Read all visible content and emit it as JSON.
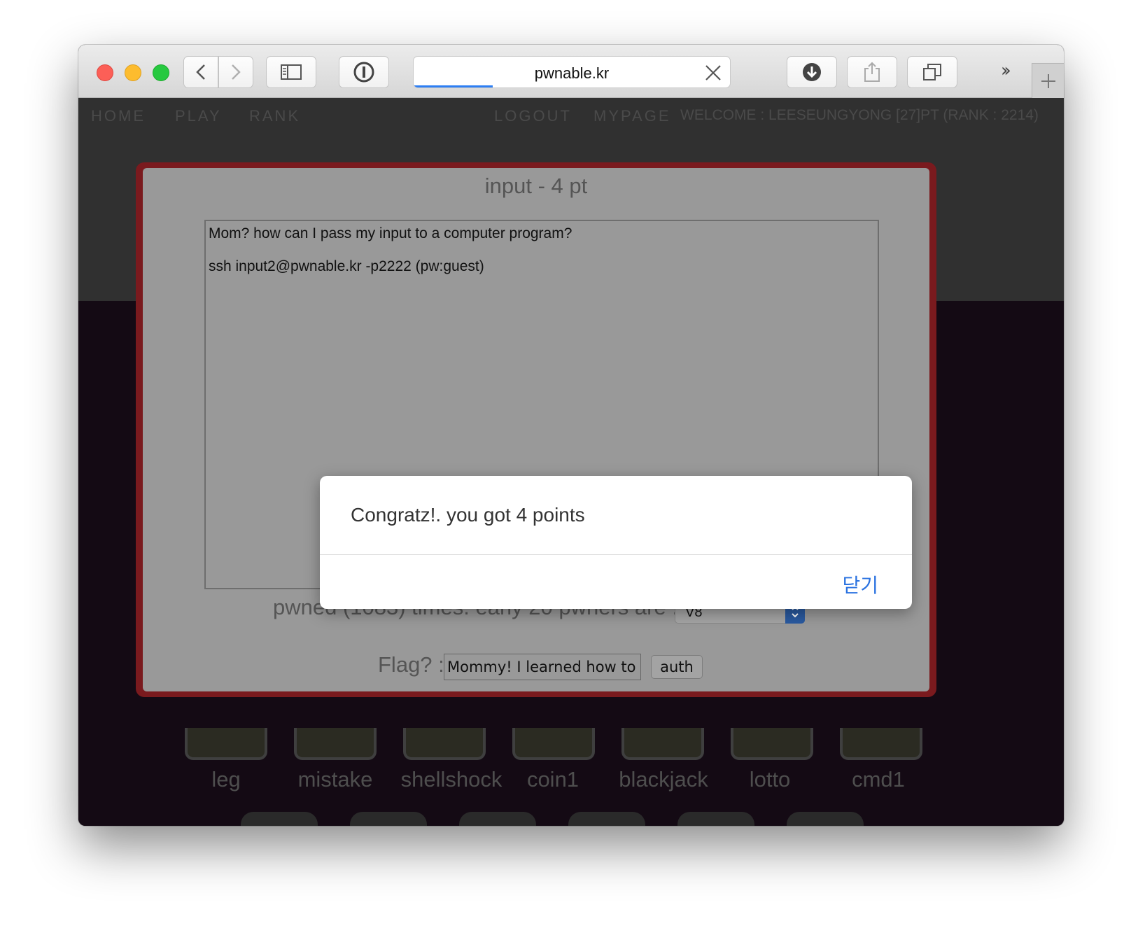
{
  "browser": {
    "url": "pwnable.kr",
    "load_progress": 0.25
  },
  "nav": {
    "home": "HOME",
    "play": "PLAY",
    "rank": "RANK",
    "logout": "LOGOUT",
    "mypage": "MYPAGE",
    "welcome": "WELCOME : LEESEUNGYONG [27]PT (RANK : 2214)"
  },
  "challenge": {
    "title": "input - 4 pt",
    "description_line1": "Mom? how can I pass my input to a computer program?",
    "description_line2": "ssh input2@pwnable.kr -p2222 (pw:guest)",
    "pwned_text": "pwned (1083) times. early 20 pwners are :",
    "pwner_selected": "V8",
    "flag_label": "Flag? :",
    "flag_value": "Mommy! I learned how to p",
    "auth_label": "auth"
  },
  "alert": {
    "message": "Congratz!. you got 4 points",
    "close_label": "닫기"
  },
  "games": [
    {
      "label": "leg"
    },
    {
      "label": "mistake"
    },
    {
      "label": "shellshock"
    },
    {
      "label": "coin1"
    },
    {
      "label": "blackjack"
    },
    {
      "label": "lotto"
    },
    {
      "label": "cmd1"
    }
  ],
  "colors": {
    "accent_link": "#2a72e0",
    "modal_border": "#7a1a1e",
    "url_progress": "#2d7ef3"
  }
}
